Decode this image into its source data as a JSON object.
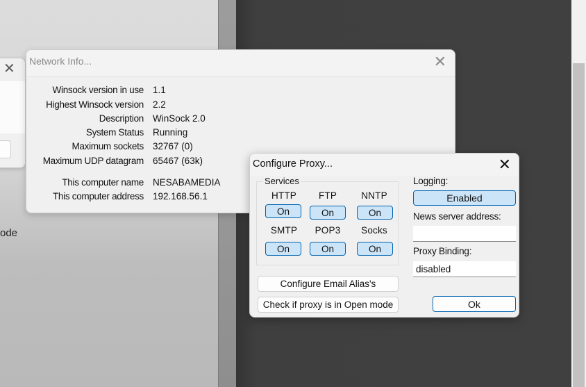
{
  "background": {
    "partial_text": "ode"
  },
  "left_dialog": {
    "close_icon": "close-icon"
  },
  "network_info": {
    "title": "Network Info...",
    "close_icon": "close-icon",
    "rows": [
      {
        "label": "Winsock version in use",
        "value": "1.1"
      },
      {
        "label": "Highest Winsock version",
        "value": "2.2"
      },
      {
        "label": "Description",
        "value": "WinSock 2.0"
      },
      {
        "label": "System Status",
        "value": "Running"
      },
      {
        "label": "Maximum sockets",
        "value": "32767 (0)"
      },
      {
        "label": "Maximum UDP datagram",
        "value": "65467 (63k)"
      },
      {
        "label": "This computer name",
        "value": "NESABAMEDIA"
      },
      {
        "label": "This computer address",
        "value": "192.168.56.1"
      }
    ]
  },
  "configure_proxy": {
    "title": "Configure Proxy...",
    "close_icon": "close-icon",
    "services_legend": "Services",
    "services": [
      {
        "name": "HTTP",
        "state": "On"
      },
      {
        "name": "FTP",
        "state": "On"
      },
      {
        "name": "NNTP",
        "state": "On"
      },
      {
        "name": "SMTP",
        "state": "On"
      },
      {
        "name": "POP3",
        "state": "On"
      },
      {
        "name": "Socks",
        "state": "On"
      }
    ],
    "logging_label": "Logging:",
    "logging_value": "Enabled",
    "news_server_label": "News server address:",
    "news_server_value": "",
    "proxy_binding_label": "Proxy Binding:",
    "proxy_binding_value": "disabled",
    "configure_email_alias_label": "Configure Email Alias's",
    "check_open_mode_label": "Check if proxy is in Open mode",
    "ok_label": "Ok"
  }
}
